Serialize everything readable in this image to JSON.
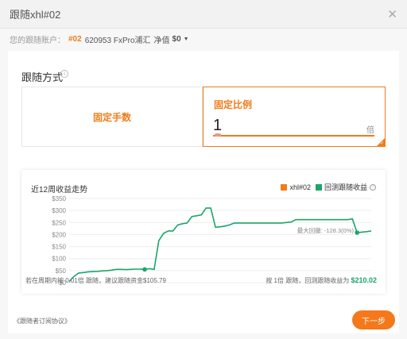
{
  "dialog": {
    "title": "跟随xhl#02",
    "close_icon": "close-icon"
  },
  "account": {
    "label": "您的跟随账户：",
    "number": "#02",
    "name": "620953 FxPro浦汇",
    "net_label": "净值",
    "net_value": "$0"
  },
  "follow_mode": {
    "title": "跟随方式",
    "options": [
      {
        "label": "固定手数"
      },
      {
        "label": "固定比例"
      }
    ],
    "selected": "固定比例",
    "ratio_value": "1",
    "ratio_unit": "倍"
  },
  "colors": {
    "accent": "#f07c1a",
    "green": "#1aa56a",
    "button": "#f5781a"
  },
  "chart": {
    "title": "近12周收益走势",
    "legend": [
      {
        "name": "xhl#02",
        "color": "#f07c1a"
      },
      {
        "name": "回测跟随收益",
        "color": "#1aa56a"
      }
    ],
    "max_drawdown": "最大回撤: -128.3(0%)"
  },
  "chart_data": {
    "type": "line",
    "title": "近12周收益走势",
    "yticks": [
      "$350",
      "$300",
      "$250",
      "$200",
      "$150",
      "$100",
      "$50",
      "$0"
    ],
    "ylim": [
      0,
      350
    ],
    "grid": true,
    "legend_position": "top-right",
    "series": [
      {
        "name": "回测跟随收益",
        "color": "#1aa56a",
        "values": [
          5,
          25,
          40,
          42,
          45,
          46,
          47,
          49,
          50,
          52,
          55,
          55,
          54,
          55,
          56,
          56,
          55,
          58,
          55,
          175,
          205,
          215,
          215,
          240,
          245,
          248,
          275,
          278,
          282,
          310,
          310,
          230,
          232,
          235,
          240,
          248,
          248,
          248,
          248,
          248,
          248,
          248,
          248,
          248,
          248,
          248,
          250,
          252,
          262,
          262,
          262,
          262,
          262,
          262,
          262,
          262,
          262,
          262,
          262,
          262,
          265,
          208,
          210,
          212,
          215
        ]
      }
    ]
  },
  "footer": {
    "left_text": "若在周期内按 0.01倍 跟随，建议跟随资金$105.79",
    "right_text": "按 1倍 跟随，回测跟随收益为",
    "right_value": "$210.02"
  },
  "agreement": "《跟随者订阅协议》",
  "next_button": "下一步"
}
